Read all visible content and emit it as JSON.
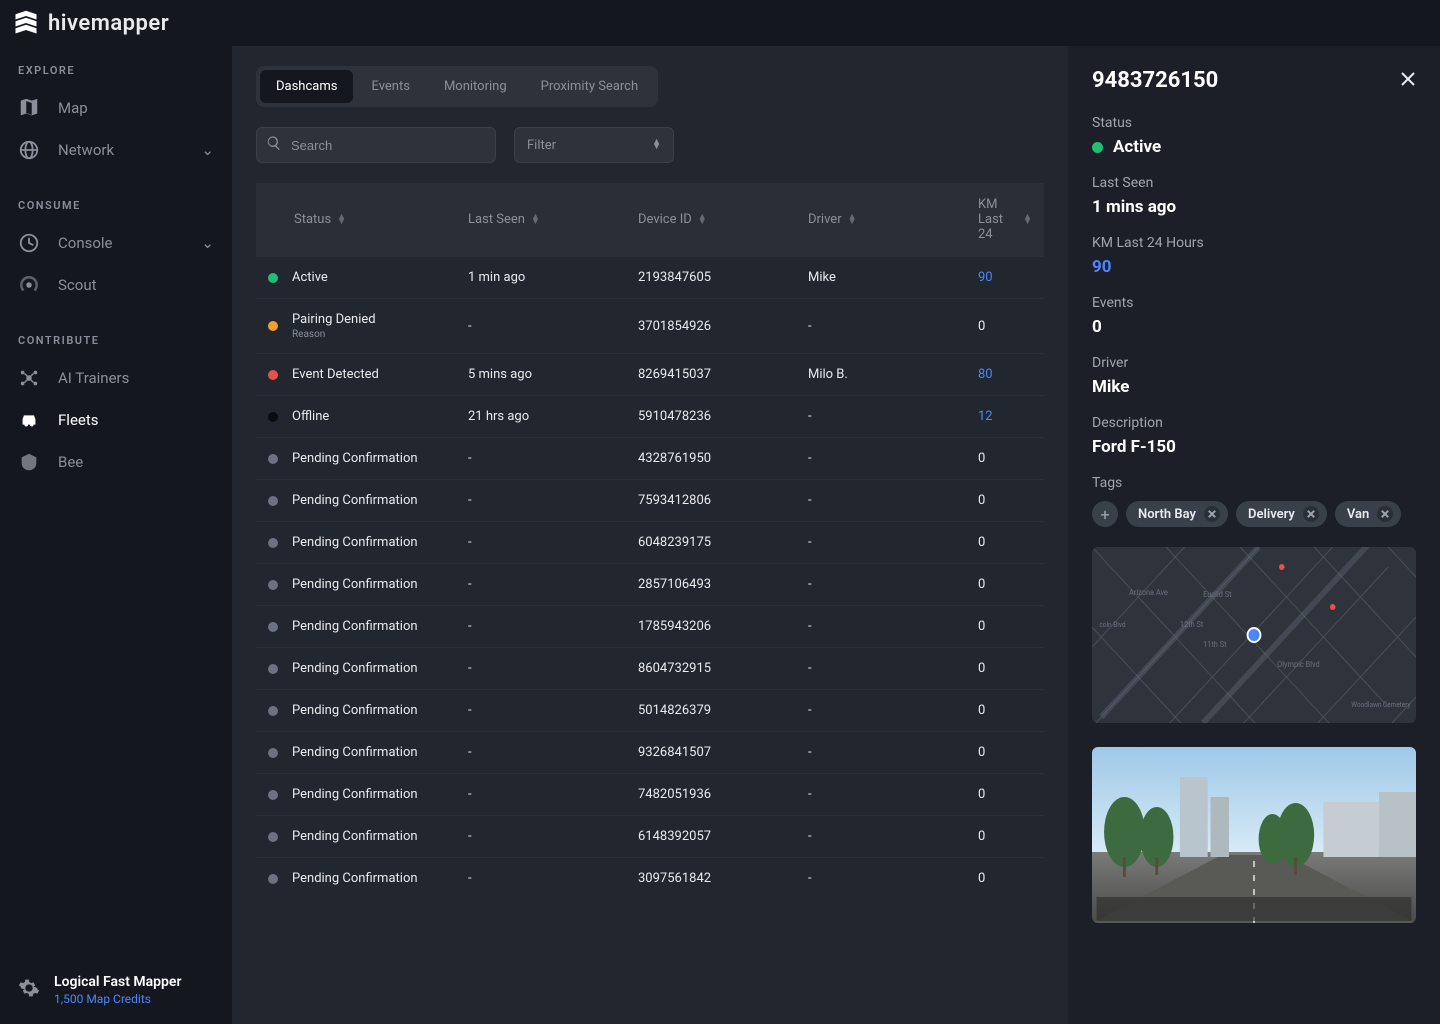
{
  "brand": "hivemapper",
  "sidebar": {
    "sections": [
      {
        "label": "EXPLORE",
        "items": [
          {
            "label": "Map",
            "active": false,
            "chevron": false
          },
          {
            "label": "Network",
            "active": false,
            "chevron": true
          }
        ]
      },
      {
        "label": "CONSUME",
        "items": [
          {
            "label": "Console",
            "active": false,
            "chevron": true
          },
          {
            "label": "Scout",
            "active": false,
            "chevron": false
          }
        ]
      },
      {
        "label": "CONTRIBUTE",
        "items": [
          {
            "label": "AI Trainers",
            "active": false,
            "chevron": false
          },
          {
            "label": "Fleets",
            "active": true,
            "chevron": false
          },
          {
            "label": "Bee",
            "active": false,
            "chevron": false
          }
        ]
      }
    ],
    "footer": {
      "name": "Logical Fast Mapper",
      "credits": "1,500 Map Credits"
    }
  },
  "tabs": [
    {
      "label": "Dashcams",
      "active": true
    },
    {
      "label": "Events",
      "active": false
    },
    {
      "label": "Monitoring",
      "active": false
    },
    {
      "label": "Proximity Search",
      "active": false
    }
  ],
  "search": {
    "placeholder": "Search",
    "value": ""
  },
  "filter": {
    "label": "Filter"
  },
  "columns": [
    "Status",
    "Last Seen",
    "Device ID",
    "Driver",
    "KM Last 24"
  ],
  "rows": [
    {
      "status": "Active",
      "dot": "green",
      "sub": "",
      "seen": "1 min ago",
      "device": "2193847605",
      "driver": "Mike",
      "km": "90",
      "kmLink": true
    },
    {
      "status": "Pairing Denied",
      "dot": "orange",
      "sub": "Reason",
      "seen": "-",
      "device": "3701854926",
      "driver": "-",
      "km": "0",
      "kmLink": false
    },
    {
      "status": "Event Detected",
      "dot": "red",
      "sub": "",
      "seen": "5 mins ago",
      "device": "8269415037",
      "driver": "Milo B.",
      "km": "80",
      "kmLink": true
    },
    {
      "status": "Offline",
      "dot": "black",
      "sub": "",
      "seen": "21 hrs ago",
      "device": "5910478236",
      "driver": "-",
      "km": "12",
      "kmLink": true
    },
    {
      "status": "Pending Confirmation",
      "dot": "gray",
      "sub": "",
      "seen": "-",
      "device": "4328761950",
      "driver": "-",
      "km": "0",
      "kmLink": false
    },
    {
      "status": "Pending Confirmation",
      "dot": "gray",
      "sub": "",
      "seen": "-",
      "device": "7593412806",
      "driver": "-",
      "km": "0",
      "kmLink": false
    },
    {
      "status": "Pending Confirmation",
      "dot": "gray",
      "sub": "",
      "seen": "-",
      "device": "6048239175",
      "driver": "-",
      "km": "0",
      "kmLink": false
    },
    {
      "status": "Pending Confirmation",
      "dot": "gray",
      "sub": "",
      "seen": "-",
      "device": "2857106493",
      "driver": "-",
      "km": "0",
      "kmLink": false
    },
    {
      "status": "Pending Confirmation",
      "dot": "gray",
      "sub": "",
      "seen": "-",
      "device": "1785943206",
      "driver": "-",
      "km": "0",
      "kmLink": false
    },
    {
      "status": "Pending Confirmation",
      "dot": "gray",
      "sub": "",
      "seen": "-",
      "device": "8604732915",
      "driver": "-",
      "km": "0",
      "kmLink": false
    },
    {
      "status": "Pending Confirmation",
      "dot": "gray",
      "sub": "",
      "seen": "-",
      "device": "5014826379",
      "driver": "-",
      "km": "0",
      "kmLink": false
    },
    {
      "status": "Pending Confirmation",
      "dot": "gray",
      "sub": "",
      "seen": "-",
      "device": "9326841507",
      "driver": "-",
      "km": "0",
      "kmLink": false
    },
    {
      "status": "Pending Confirmation",
      "dot": "gray",
      "sub": "",
      "seen": "-",
      "device": "7482051936",
      "driver": "-",
      "km": "0",
      "kmLink": false
    },
    {
      "status": "Pending Confirmation",
      "dot": "gray",
      "sub": "",
      "seen": "-",
      "device": "6148392057",
      "driver": "-",
      "km": "0",
      "kmLink": false
    },
    {
      "status": "Pending Confirmation",
      "dot": "gray",
      "sub": "",
      "seen": "-",
      "device": "3097561842",
      "driver": "-",
      "km": "0",
      "kmLink": false
    }
  ],
  "detail": {
    "title": "9483726150",
    "fields": {
      "status_label": "Status",
      "status_value": "Active",
      "seen_label": "Last Seen",
      "seen_value": "1 mins ago",
      "km_label": "KM Last 24 Hours",
      "km_value": "90",
      "events_label": "Events",
      "events_value": "0",
      "driver_label": "Driver",
      "driver_value": "Mike",
      "desc_label": "Description",
      "desc_value": "Ford F-150",
      "tags_label": "Tags"
    },
    "tags": [
      "North Bay",
      "Delivery",
      "Van"
    ]
  }
}
